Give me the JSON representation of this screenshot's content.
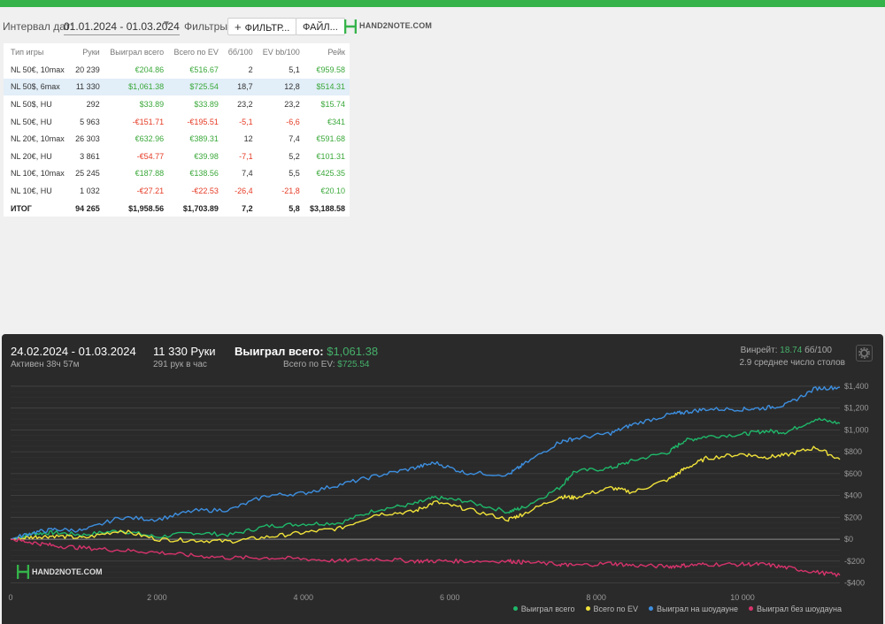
{
  "filters": {
    "date_label": "Интервал дат:",
    "date_value": "01.01.2024 - 01.03.2024",
    "filters_label": "Фильтры:",
    "filter_button": "ФИЛЬТР...",
    "file_button": "ФАЙЛ...",
    "logo_text": "HAND2NOTE.COM"
  },
  "table": {
    "headers": [
      "Тип игры",
      "Руки",
      "Выиграл всего",
      "Всего по EV",
      "бб/100",
      "EV bb/100",
      "Рейк"
    ],
    "rows": [
      [
        "NL 50€, 10max",
        "20 239",
        "€204.86",
        "€516.67",
        "2",
        "5,1",
        "€959.58"
      ],
      [
        "NL 50$, 6max",
        "11 330",
        "$1,061.38",
        "$725.54",
        "18,7",
        "12,8",
        "$514.31"
      ],
      [
        "NL 50$, HU",
        "292",
        "$33.89",
        "$33.89",
        "23,2",
        "23,2",
        "$15.74"
      ],
      [
        "NL 50€, HU",
        "5 963",
        "-€151.71",
        "-€195.51",
        "-5,1",
        "-6,6",
        "€341"
      ],
      [
        "NL 20€, 10max",
        "26 303",
        "€632.96",
        "€389.31",
        "12",
        "7,4",
        "€591.68"
      ],
      [
        "NL 20€, HU",
        "3 861",
        "-€54.77",
        "€39.98",
        "-7,1",
        "5,2",
        "€101.31"
      ],
      [
        "NL 10€, 10max",
        "25 245",
        "€187.88",
        "€138.56",
        "7,4",
        "5,5",
        "€425.35"
      ],
      [
        "NL 10€, HU",
        "1 032",
        "-€27.21",
        "-€22.53",
        "-26,4",
        "-21,8",
        "€20.10"
      ]
    ],
    "total": [
      "ИТОГ",
      "94 265",
      "$1,958.56",
      "$1,703.89",
      "7,2",
      "5,8",
      "$3,188.58"
    ],
    "selected_row": 1
  },
  "panel": {
    "date_range": "24.02.2024 - 01.03.2024",
    "active": "Активен 38ч 57м",
    "hands": "11 330 Руки",
    "hands_per_hour": "291 рук в час",
    "won_label": "Выиграл всего:",
    "won_value": "$1,061.38",
    "ev_label": "Всего по EV:",
    "ev_value": "$725.54",
    "winrate_label": "Винрейт:",
    "winrate_value": "18.74",
    "winrate_unit": "бб/100",
    "tables_text": "2.9 среднее число столов",
    "logo_text": "HAND2NOTE.COM"
  },
  "colors": {
    "accent": "#35b34a",
    "won": "#1fb86a",
    "ev": "#f0e23a",
    "showdown": "#3d8fe0",
    "nonshowdown": "#d6336c"
  },
  "chart_data": {
    "type": "line",
    "x_ticks": [
      0,
      2000,
      4000,
      6000,
      8000,
      10000
    ],
    "x_tick_labels": [
      "0",
      "2 000",
      "4 000",
      "6 000",
      "8 000",
      "10 000"
    ],
    "xlim": [
      0,
      11330
    ],
    "y_ticks": [
      1400,
      1200,
      1000,
      800,
      600,
      400,
      200,
      0,
      -200,
      -400
    ],
    "y_tick_labels": [
      "$1,400",
      "$1,200",
      "$1,000",
      "$800",
      "$600",
      "$400",
      "$200",
      "$0",
      "-$200",
      "-$400"
    ],
    "ylim": [
      -420,
      1440
    ],
    "grid": true,
    "legend": "bottom-right",
    "series": [
      {
        "name": "Выиграл всего",
        "color": "#1fb86a",
        "x": [
          0,
          300,
          600,
          1000,
          1500,
          2000,
          2500,
          3000,
          3500,
          4000,
          4500,
          5000,
          5500,
          5800,
          6200,
          6800,
          7000,
          7500,
          7700,
          8200,
          8500,
          9000,
          9200,
          9500,
          10000,
          10300,
          10600,
          11000,
          11330
        ],
        "y": [
          0,
          50,
          60,
          40,
          80,
          20,
          60,
          40,
          120,
          140,
          150,
          270,
          320,
          380,
          350,
          250,
          290,
          470,
          620,
          650,
          720,
          800,
          900,
          940,
          960,
          990,
          980,
          1100,
          1060
        ]
      },
      {
        "name": "Всего по EV",
        "color": "#f0e23a",
        "x": [
          0,
          300,
          600,
          1000,
          1500,
          2000,
          2500,
          3000,
          3500,
          4000,
          4500,
          5000,
          5500,
          5800,
          6200,
          6800,
          7000,
          7500,
          7700,
          8200,
          8500,
          9000,
          9200,
          9500,
          10000,
          10300,
          10600,
          11000,
          11330
        ],
        "y": [
          0,
          20,
          30,
          10,
          80,
          0,
          -10,
          -20,
          20,
          60,
          100,
          230,
          250,
          340,
          280,
          180,
          230,
          390,
          380,
          470,
          430,
          550,
          640,
          740,
          780,
          750,
          770,
          840,
          730
        ]
      },
      {
        "name": "Выиграл на шоудауне",
        "color": "#3d8fe0",
        "x": [
          0,
          300,
          600,
          1000,
          1500,
          2000,
          2500,
          3000,
          3500,
          4000,
          4500,
          5000,
          5500,
          5800,
          6200,
          6800,
          7000,
          7500,
          7700,
          8200,
          8500,
          9000,
          9200,
          9500,
          10000,
          10300,
          10600,
          11000,
          11330
        ],
        "y": [
          0,
          60,
          90,
          80,
          200,
          180,
          260,
          270,
          400,
          420,
          500,
          580,
          650,
          700,
          610,
          590,
          680,
          890,
          920,
          970,
          1050,
          1140,
          1160,
          1190,
          1190,
          1200,
          1230,
          1380,
          1390
        ]
      },
      {
        "name": "Выиграл без шоудауна",
        "color": "#d6336c",
        "x": [
          0,
          300,
          600,
          1000,
          1500,
          2000,
          2500,
          3000,
          3500,
          4000,
          4500,
          5000,
          5500,
          5800,
          6200,
          6800,
          7000,
          7500,
          7700,
          8200,
          8500,
          9000,
          9200,
          9500,
          10000,
          10300,
          10600,
          11000,
          11330
        ],
        "y": [
          0,
          -30,
          -60,
          -80,
          -100,
          -120,
          -150,
          -170,
          -170,
          -180,
          -200,
          -180,
          -200,
          -200,
          -200,
          -200,
          -210,
          -230,
          -240,
          -220,
          -240,
          -250,
          -240,
          -230,
          -230,
          -230,
          -260,
          -300,
          -330
        ]
      }
    ]
  }
}
